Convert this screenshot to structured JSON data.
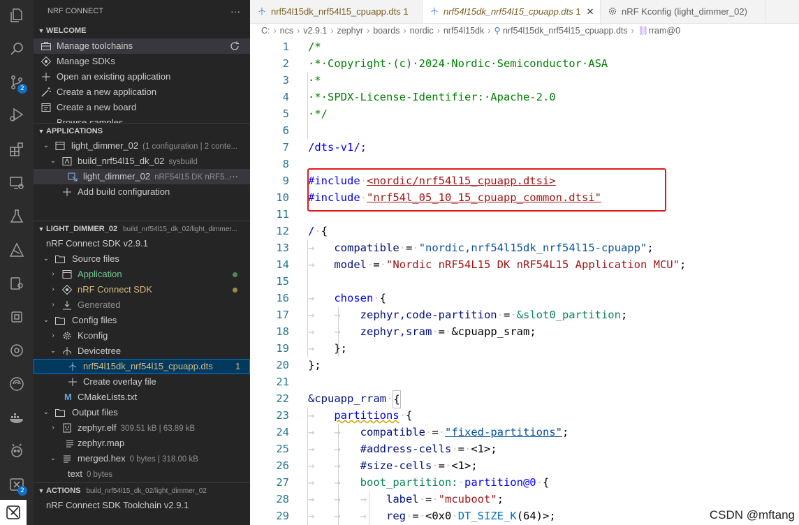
{
  "sidebar": {
    "title": "NRF CONNECT",
    "more": "···",
    "welcome": {
      "header": "WELCOME",
      "items": [
        "Manage toolchains",
        "Manage SDKs",
        "Open an existing application",
        "Create a new application",
        "Create a new board",
        "Browse samples"
      ]
    },
    "applications": {
      "header": "APPLICATIONS",
      "app_name": "light_dimmer_02",
      "app_desc": "(1 configuration | 2 conte...",
      "build_name": "build_nrf54l15_dk_02",
      "build_desc": "sysbuild",
      "target_name": "light_dimmer_02",
      "target_desc": "nRF54l15 DK nRF5...",
      "target_more": "···",
      "add_build": "Add build configuration"
    },
    "light_dimmer": {
      "header": "LIGHT_DIMMER_02",
      "header_sub": "build_nrf54l15_dk_02/light_dimmer...",
      "sdk": "nRF Connect SDK v2.9.1",
      "source_files": "Source files",
      "application": "Application",
      "nrf_connect_sdk": "nRF Connect SDK",
      "generated": "Generated",
      "config_files": "Config files",
      "kconfig": "Kconfig",
      "devicetree": "Devicetree",
      "dts_file": "nrf54l15dk_nrf54l15_cpuapp.dts",
      "dts_count": "1",
      "create_overlay": "Create overlay file",
      "cmakelists": "CMakeLists.txt",
      "output_files": "Output files",
      "zephyr_elf": "zephyr.elf",
      "zephyr_elf_size": "309.51 kB | 63.89 kB",
      "zephyr_map": "zephyr.map",
      "merged_hex": "merged.hex",
      "merged_hex_size": "0 bytes | 318.00 kB",
      "text": "text",
      "text_size": "0 bytes"
    },
    "actions": {
      "header": "ACTIONS",
      "header_sub": "build_nrf54l15_dk_02/light_dimmer_02",
      "toolchain": "nRF Connect SDK Toolchain v2.9.1"
    }
  },
  "activity_badges": {
    "source_control": "2",
    "extension": "2"
  },
  "tabs": [
    {
      "label": "nrf54l15dk_nrf54l15_cpuapp.dts",
      "badge": "1"
    },
    {
      "label": "nrf54l15dk_nrf54l15_cpuapp.dts",
      "badge": "1",
      "close": "✕"
    },
    {
      "label": "nRF Kconfig (light_dimmer_02)"
    }
  ],
  "breadcrumb": [
    "C:",
    "ncs",
    "v2.9.1",
    "zephyr",
    "boards",
    "nordic",
    "nrf54l15dk",
    "nrf54l15dk_nrf54l15_cpuapp.dts",
    "rram@0"
  ],
  "code": {
    "line_numbers": [
      "1",
      "2",
      "3",
      "4",
      "5",
      "6",
      "7",
      "8",
      "9",
      "10",
      "11",
      "12",
      "13",
      "14",
      "15",
      "16",
      "17",
      "18",
      "19",
      "20",
      "21",
      "22",
      "23",
      "24",
      "25",
      "26",
      "27",
      "28",
      "29"
    ],
    "l1": "/*",
    "l2": "·*·Copyright·(c)·2024·Nordic·Semiconductor·ASA",
    "l3": "·*",
    "l4": "·*·SPDX-License-Identifier:·Apache-2.0",
    "l5": "·*/",
    "l7": "/dts-v1/;",
    "l9a": "#include",
    "l9b": "<nordic/nrf54l15_cpuapp.dtsi>",
    "l10a": "#include",
    "l10b": "\"nrf54l_05_10_15_cpuapp_common.dtsi\"",
    "l12a": "/",
    "l12b": "{",
    "l13a": "compatible",
    "l13b": "=",
    "l13c": "\"nordic,nrf54l15dk_nrf54l15-cpuapp\"",
    "l14a": "model",
    "l14b": "=",
    "l14c": "\"Nordic nRF54L15 DK nRF54L15 Application MCU\"",
    "l16a": "chosen",
    "l16b": "{",
    "l17a": "zephyr,code-partition",
    "l17b": "=",
    "l17c": "&slot0_partition",
    "l18a": "zephyr,sram",
    "l18b": "=",
    "l18c": "&cpuapp_sram",
    "l19": "};",
    "l20": "};",
    "l22a": "&cpuapp_rram",
    "l22b": "{",
    "l23a": "partitions",
    "l23b": "{",
    "l24a": "compatible",
    "l24b": "=",
    "l24c": "\"fixed-partitions\"",
    "l25a": "#address-cells",
    "l25b": "=",
    "l25c": "<1>;",
    "l26a": "#size-cells",
    "l26b": "=",
    "l26c": "<1>;",
    "l27a": "boot_partition:",
    "l27b": "partition@0",
    "l27c": "{",
    "l28a": "label",
    "l28b": "=",
    "l28c": "\"mcuboot\"",
    "l29a": "reg",
    "l29b": "=",
    "l29c": "<0x0",
    "l29d": "DT_SIZE_K",
    "l29e": "(64)>;"
  },
  "watermark": "CSDN @mftang"
}
